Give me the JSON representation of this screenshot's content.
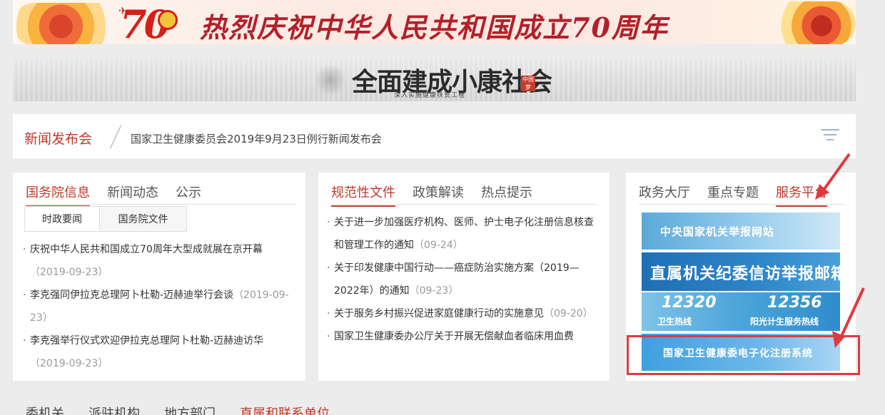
{
  "banner70": {
    "number": "70",
    "title": "热烈庆祝中华人民共和国成立70周年"
  },
  "banner2": {
    "title": "全面建成小康社会",
    "subtitle": "深入实施健康扶贫工程",
    "seal": "中国梦"
  },
  "news_conference": {
    "label": "新闻发布会",
    "headline": "国家卫生健康委员会2019年9月23日例行新闻发布会"
  },
  "panel_state_council": {
    "tabs": [
      "国务院信息",
      "新闻动态",
      "公示"
    ],
    "subtabs": [
      "时政要闻",
      "国务院文件"
    ],
    "items": [
      {
        "title": "庆祝中华人民共和国成立70周年大型成就展在京开幕",
        "date": "（2019-09-23）"
      },
      {
        "title": "李克强同伊拉克总理阿卜杜勒-迈赫迪举行会谈",
        "date": "（2019-09-23）"
      },
      {
        "title": "李克强举行仪式欢迎伊拉克总理阿卜杜勒-迈赫迪访华",
        "date": "（2019-09-23）"
      }
    ]
  },
  "panel_documents": {
    "tabs": [
      "规范性文件",
      "政策解读",
      "热点提示"
    ],
    "items": [
      {
        "title": "关于进一步加强医疗机构、医师、护士电子化注册信息核查和管理工作的通知",
        "date": "（09-24）"
      },
      {
        "title": "关于印发健康中国行动——癌症防治实施方案（2019—2022年）的通知",
        "date": "（09-23）"
      },
      {
        "title": "关于服务乡村振兴促进家庭健康行动的实施意见",
        "date": "（09-20）"
      },
      {
        "title": "国家卫生健康委办公厅关于开展无偿献血者临床用血费",
        "date": ""
      }
    ]
  },
  "panel_services": {
    "tabs": [
      "政务大厅",
      "重点专题",
      "服务平台"
    ],
    "links": {
      "central_report": "中央国家机关举报网站",
      "discipline_mailbox": "直属机关纪委信访举报邮箱",
      "hotline_12320_num": "12320",
      "hotline_12320_cap": "卫生热线",
      "hotline_12356_num": "12356",
      "hotline_12356_cap": "阳光计生服务热线",
      "e_registration": "国家卫生健康委电子化注册系统"
    }
  },
  "bottom_tabs": [
    "委机关",
    "派驻机构",
    "地方部门",
    "直属和联系单位"
  ],
  "colors": {
    "accent_red": "#c0392b",
    "annotation_red": "#e0393e",
    "background": "#ececec"
  }
}
